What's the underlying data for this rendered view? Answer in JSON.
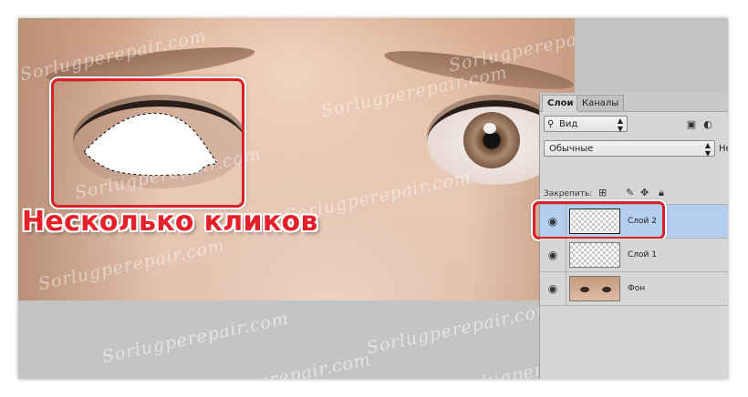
{
  "annotation": {
    "caption": "Несколько кликов",
    "accent_color": "#e4202a"
  },
  "watermark": "Sorlugperepair.com",
  "layers_panel": {
    "tabs": [
      {
        "label": "Слои",
        "active": true
      },
      {
        "label": "Каналы",
        "active": false
      }
    ],
    "filter_select": "Вид",
    "blend_mode": "Обычные",
    "opacity_label_partial": "Не",
    "lock_label": "Закрепить:",
    "layers": [
      {
        "name": "Слой 2",
        "visible": true,
        "selected": true,
        "thumbnail": "transparent"
      },
      {
        "name": "Слой 1",
        "visible": true,
        "selected": false,
        "thumbnail": "transparent"
      },
      {
        "name": "Фон",
        "visible": true,
        "selected": false,
        "thumbnail": "photo"
      }
    ],
    "icons": {
      "filter": "search-icon",
      "image_filter": "image-icon",
      "adjust_filter": "circle-half-icon",
      "visibility": "eye-icon"
    }
  }
}
